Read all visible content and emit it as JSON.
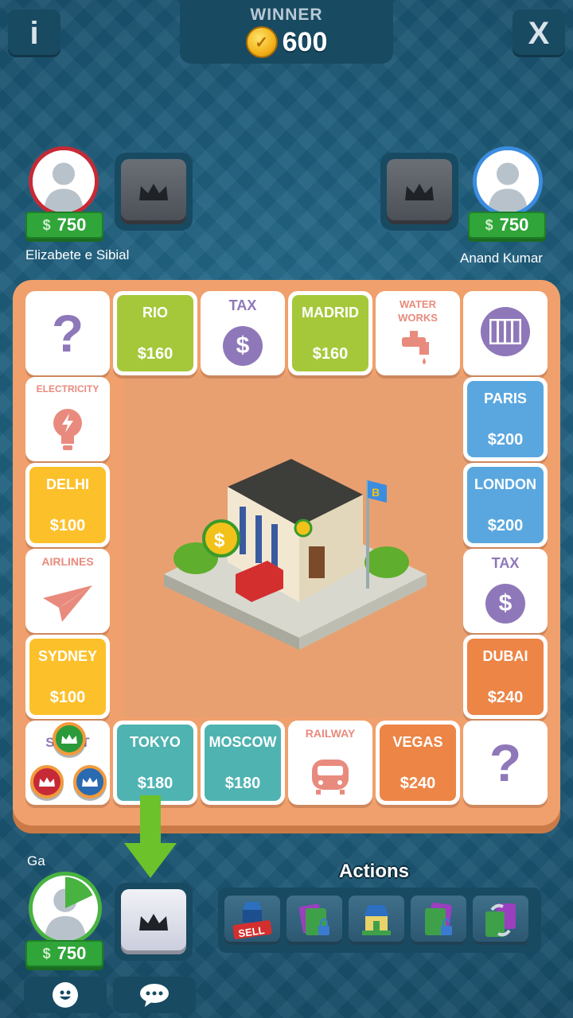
{
  "header": {
    "info_label": "i",
    "close_label": "X",
    "winner_label": "WINNER",
    "winner_amount": "600"
  },
  "players": {
    "top_left": {
      "name": "Elizabete e Sibial",
      "cash": "750",
      "ring_color": "#c62a36"
    },
    "top_right": {
      "name": "Anand Kumar",
      "cash": "750",
      "ring_color": "#3b8de0"
    },
    "current": {
      "name": "Ga",
      "cash": "750",
      "ring_color": "#49b341"
    }
  },
  "board": {
    "top_row": [
      {
        "type": "chance",
        "label": "?"
      },
      {
        "type": "city",
        "name": "RIO",
        "price": "$160",
        "color": "#a5c83a"
      },
      {
        "type": "tax",
        "name": "TAX"
      },
      {
        "type": "city",
        "name": "MADRID",
        "price": "$160",
        "color": "#a5c83a"
      },
      {
        "type": "utility",
        "name": "WATER WORKS"
      },
      {
        "type": "jail"
      }
    ],
    "left_col": [
      {
        "type": "utility",
        "name": "ELECTRICITY"
      },
      {
        "type": "city",
        "name": "DELHI",
        "price": "$100",
        "color": "#fcc12a"
      },
      {
        "type": "transport",
        "name": "AIRLINES"
      },
      {
        "type": "city",
        "name": "SYDNEY",
        "price": "$100",
        "color": "#fcc12a"
      }
    ],
    "right_col": [
      {
        "type": "city",
        "name": "PARIS",
        "price": "$200",
        "color": "#5aa7df"
      },
      {
        "type": "city",
        "name": "LONDON",
        "price": "$200",
        "color": "#5aa7df"
      },
      {
        "type": "tax",
        "name": "TAX"
      },
      {
        "type": "city",
        "name": "DUBAI",
        "price": "$240",
        "color": "#ec8546"
      }
    ],
    "bottom_row": [
      {
        "type": "start",
        "name": "START"
      },
      {
        "type": "city",
        "name": "TOKYO",
        "price": "$180",
        "color": "#4fb3b1"
      },
      {
        "type": "city",
        "name": "MOSCOW",
        "price": "$180",
        "color": "#4fb3b1"
      },
      {
        "type": "transport",
        "name": "RAILWAY"
      },
      {
        "type": "city",
        "name": "VEGAS",
        "price": "$240",
        "color": "#ec8546"
      },
      {
        "type": "chance",
        "label": "?"
      }
    ],
    "center_flag_letter": "B"
  },
  "actions": {
    "title": "Actions",
    "sell_label": "SELL",
    "items": [
      "sell-house-icon",
      "mortgage-card-icon",
      "build-house-icon",
      "unmortgage-card-icon",
      "trade-cards-icon"
    ]
  },
  "colors": {
    "background": "#1d5a78",
    "panel": "#184a62",
    "board": "#f0a06c",
    "cash_green": "#2fa53a",
    "accent_purple": "#8f78b9"
  }
}
